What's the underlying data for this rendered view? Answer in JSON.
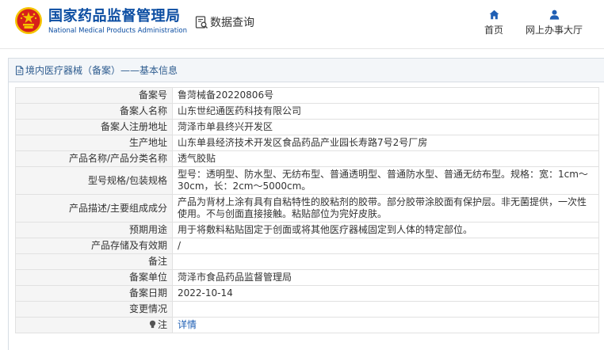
{
  "header": {
    "org_name_cn": "国家药品监督管理局",
    "org_name_en": "National Medical Products Administration",
    "data_query_label": "数据查询",
    "nav": {
      "home_label": "首页",
      "office_label": "网上办事大厅"
    },
    "colors": {
      "brand_blue": "#0b4da2",
      "emblem_red": "#d7201a",
      "emblem_gold": "#f5c400"
    }
  },
  "panel": {
    "title": "境内医疗器械（备案）——基本信息"
  },
  "record": {
    "rows": [
      {
        "label": "备案号",
        "value": "鲁菏械备20220806号"
      },
      {
        "label": "备案人名称",
        "value": "山东世纪通医药科技有限公司"
      },
      {
        "label": "备案人注册地址",
        "value": "菏泽市单县终兴开发区"
      },
      {
        "label": "生产地址",
        "value": "山东单县经济技术开发区食品药品产业园长寿路7号2号厂房"
      },
      {
        "label": "产品名称/产品分类名称",
        "value": "透气胶贴"
      },
      {
        "label": "型号规格/包装规格",
        "value": "型号：透明型、防水型、无纺布型、普通透明型、普通防水型、普通无纺布型。规格：宽：1cm～30cm，长：2cm～5000cm。"
      },
      {
        "label": "产品描述/主要组成成分",
        "value": "产品为背材上涂有具有自粘特性的胶粘剂的胶带。部分胶带涂胶面有保护层。非无菌提供，一次性使用。不与创面直接接触。粘贴部位为完好皮肤。"
      },
      {
        "label": "预期用途",
        "value": "用于将敷料粘贴固定于创面或将其他医疗器械固定到人体的特定部位。"
      },
      {
        "label": "产品存储及有效期",
        "value": "/"
      },
      {
        "label": "备注",
        "value": ""
      },
      {
        "label": "备案单位",
        "value": "菏泽市食品药品监督管理局"
      },
      {
        "label": "备案日期",
        "value": "2022-10-14"
      },
      {
        "label": "变更情况",
        "value": ""
      },
      {
        "label": "注",
        "value": "详情"
      }
    ]
  }
}
